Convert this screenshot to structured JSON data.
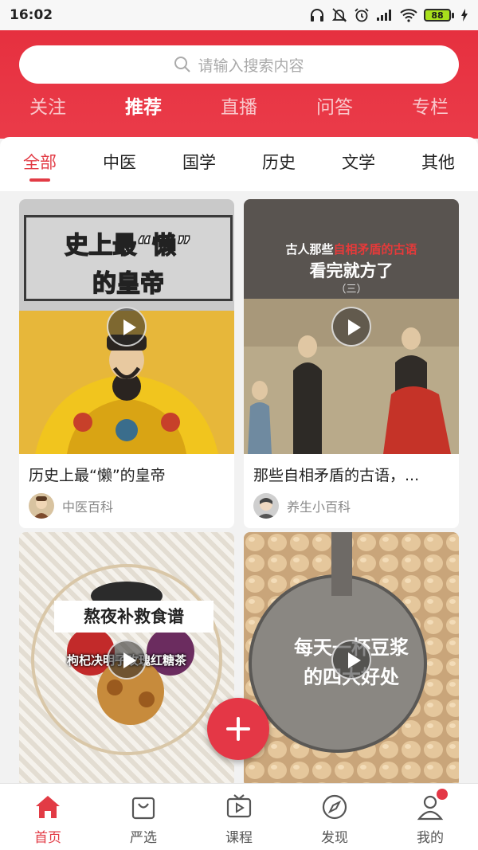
{
  "status_bar": {
    "time": "16:02",
    "battery": "88",
    "icons": [
      "headphones-icon",
      "bell-off-icon",
      "alarm-icon",
      "signal-icon",
      "wifi-icon",
      "battery-icon",
      "charging-icon"
    ]
  },
  "header": {
    "search_placeholder": "请输入搜索内容",
    "tabs": [
      {
        "label": "关注",
        "active": false
      },
      {
        "label": "推荐",
        "active": true
      },
      {
        "label": "直播",
        "active": false
      },
      {
        "label": "问答",
        "active": false
      },
      {
        "label": "专栏",
        "active": false
      }
    ]
  },
  "categories": [
    {
      "label": "全部",
      "active": true
    },
    {
      "label": "中医",
      "active": false
    },
    {
      "label": "国学",
      "active": false
    },
    {
      "label": "历史",
      "active": false
    },
    {
      "label": "文学",
      "active": false
    },
    {
      "label": "其他",
      "active": false
    }
  ],
  "cards": [
    {
      "thumb_line1": "史上最“懒”",
      "thumb_line2": "的皇帝",
      "title": "历史上最“懒”的皇帝",
      "author": "中医百科"
    },
    {
      "thumb_line1_a": "古人那些",
      "thumb_line1_b": "自相矛盾的古语",
      "thumb_line2": "看完就方了",
      "thumb_line3": "（三）",
      "title": "那些自相矛盾的古语，...",
      "author": "养生小百科"
    },
    {
      "thumb_line1": "熬夜补救食谱",
      "thumb_line2": "枸杞决明子玫瑰红糖茶"
    },
    {
      "thumb_line1": "每天一杯豆浆",
      "thumb_line2": "的四大好处"
    }
  ],
  "bottom_nav": [
    {
      "label": "首页",
      "icon": "home-icon",
      "active": true
    },
    {
      "label": "严选",
      "icon": "shopping-bag-icon",
      "active": false
    },
    {
      "label": "课程",
      "icon": "tv-play-icon",
      "active": false
    },
    {
      "label": "发现",
      "icon": "compass-icon",
      "active": false
    },
    {
      "label": "我的",
      "icon": "user-icon",
      "active": false
    }
  ],
  "colors": {
    "brand_red": "#e6303f",
    "active_tab": "#e23b45"
  }
}
